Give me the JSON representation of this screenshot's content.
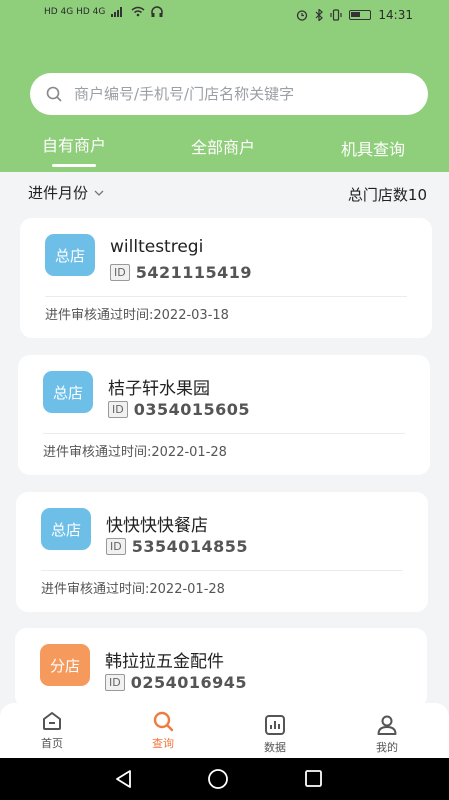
{
  "status_bar": {
    "left_indicators": "HD 4G HD 4G",
    "time": "14:31"
  },
  "search": {
    "placeholder": "商户编号/手机号/门店名称关键字"
  },
  "tabs": [
    {
      "label": "自有商户",
      "active": true
    },
    {
      "label": "全部商户",
      "active": false
    },
    {
      "label": "机具查询",
      "active": false
    }
  ],
  "filter": {
    "month_label": "进件月份",
    "store_count": "总门店数10"
  },
  "merchants": [
    {
      "badge": "总店",
      "type": "main",
      "name": "willtestregi",
      "id_tag": "ID",
      "id": "5421115419",
      "approved": "进件审核通过时间:2022-03-18"
    },
    {
      "badge": "总店",
      "type": "main",
      "name": "桔子轩水果园",
      "id_tag": "ID",
      "id": "0354015605",
      "approved": "进件审核通过时间:2022-01-28"
    },
    {
      "badge": "总店",
      "type": "main",
      "name": "快快快快餐店",
      "id_tag": "ID",
      "id": "5354014855",
      "approved": "进件审核通过时间:2022-01-28"
    },
    {
      "badge": "分店",
      "type": "branch",
      "name": "韩拉拉五金配件",
      "id_tag": "ID",
      "id": "0254016945",
      "approved": ""
    }
  ],
  "bottom_nav": [
    {
      "label": "首页",
      "icon": "home-icon",
      "active": false
    },
    {
      "label": "查询",
      "icon": "search-icon",
      "active": true
    },
    {
      "label": "数据",
      "icon": "chart-icon",
      "active": false
    },
    {
      "label": "我的",
      "icon": "user-icon",
      "active": false
    }
  ],
  "colors": {
    "header_green": "#8fce7b",
    "active_orange": "#f07b3f",
    "main_badge": "#6ebfe8",
    "branch_badge": "#f59a5c"
  }
}
